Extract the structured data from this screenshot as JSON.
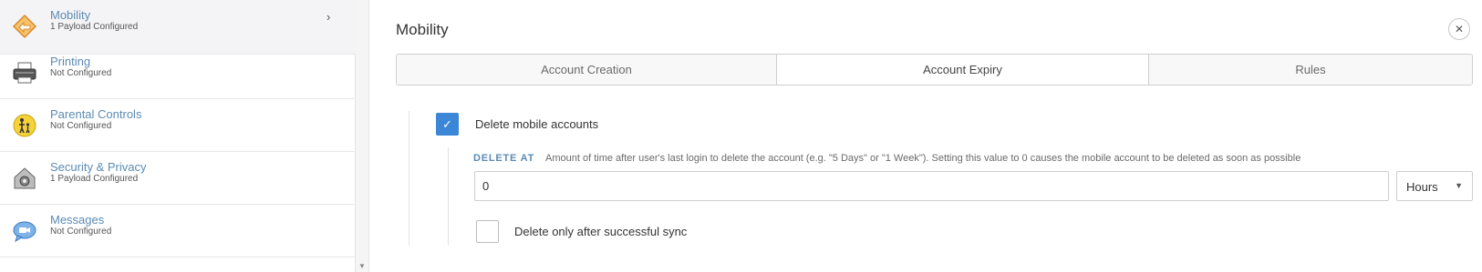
{
  "sidebar": {
    "items": [
      {
        "title": "Mobility",
        "subtitle": "1 Payload Configured",
        "icon": "mobility-icon",
        "selected": true
      },
      {
        "title": "Printing",
        "subtitle": "Not Configured",
        "icon": "printer-icon",
        "selected": false
      },
      {
        "title": "Parental Controls",
        "subtitle": "Not Configured",
        "icon": "parental-controls-icon",
        "selected": false
      },
      {
        "title": "Security & Privacy",
        "subtitle": "1 Payload Configured",
        "icon": "security-icon",
        "selected": false
      },
      {
        "title": "Messages",
        "subtitle": "Not Configured",
        "icon": "messages-icon",
        "selected": false
      }
    ],
    "chevron": "›"
  },
  "panel": {
    "title": "Mobility",
    "close_glyph": "✕",
    "tabs": [
      {
        "label": "Account Creation",
        "active": false
      },
      {
        "label": "Account Expiry",
        "active": true
      },
      {
        "label": "Rules",
        "active": false
      }
    ],
    "delete_mobile": {
      "label": "Delete mobile accounts",
      "checked": true,
      "check_glyph": "✓"
    },
    "delete_at": {
      "label": "DELETE AT",
      "description": "Amount of time after user's last login to delete the account (e.g. \"5 Days\" or \"1 Week\"). Setting this value to 0 causes the mobile account to be deleted as soon as possible",
      "value": "0",
      "unit": "Hours",
      "caret": "▼"
    },
    "delete_after_sync": {
      "label": "Delete only after successful sync",
      "checked": false
    }
  },
  "colors": {
    "accent": "#3b86d6",
    "link_blue": "#5b8bb3",
    "selected_bg": "#f4f4f7",
    "border": "#cfcfcf"
  }
}
